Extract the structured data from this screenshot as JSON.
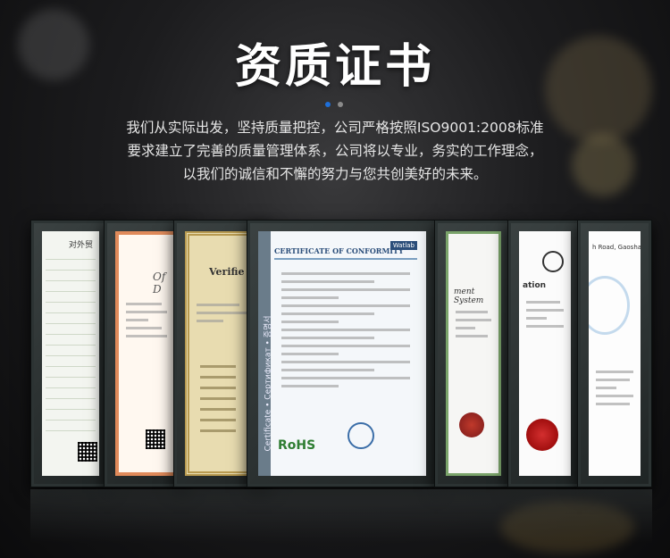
{
  "heading": {
    "title": "资质证书"
  },
  "intro": {
    "lines": [
      "我们从实际出发，坚持质量把控，公司严格按照ISO9001:2008标准",
      "要求建立了完善的质量管理体系，公司将以专业，务实的工作理念，",
      "以我们的诚信和不懈的努力与您共创美好的未来。"
    ]
  },
  "certificates": {
    "c1": {
      "heading": "对外贸"
    },
    "c2": {
      "heading": "Of D"
    },
    "c3": {
      "heading": "Verifie"
    },
    "c4": {
      "heading": "CERTIFICATE OF CONFORMITY",
      "badge": "Watlab",
      "side_text": "Certificate • Сертификат • 증명서",
      "mark": "RoHS"
    },
    "c5": {
      "heading": "ment System"
    },
    "c6": {
      "heading": "ation"
    },
    "c7": {
      "heading": "h Road, Gaoshan"
    }
  },
  "colors": {
    "accent_dot": "#1e6fd9",
    "frame": "#2c3333",
    "background": "#1c1c1e"
  }
}
